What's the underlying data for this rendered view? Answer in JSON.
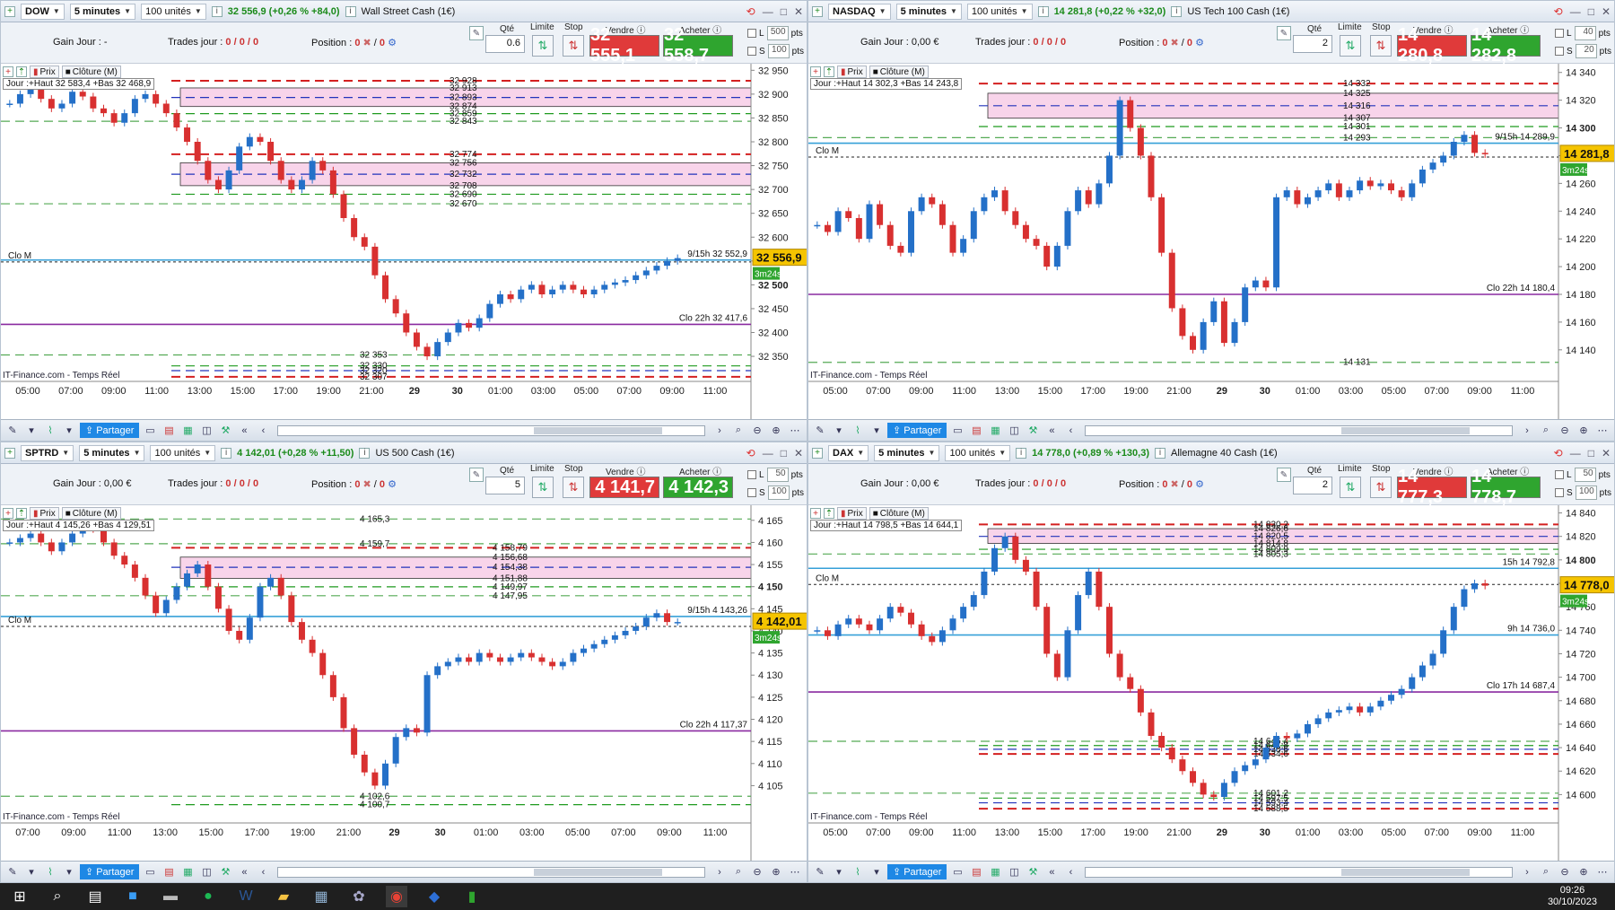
{
  "panels": [
    {
      "symbol": "DOW",
      "timeframe": "5 minutes",
      "units": "100 unités",
      "quote": "32 556,9 (+0,26 % +84,0)",
      "instrument": "Wall Street Cash (1€)",
      "gain_label": "Gain Jour :",
      "gain_value": "-",
      "trades_label": "Trades jour :",
      "trades_value": "0 / 0 / 0",
      "position_label": "Position :",
      "position_value": "0",
      "position_extra": "0",
      "qty_label": "Qté",
      "qty_value": "0.6",
      "limit_label": "Limite",
      "stop_label": "Stop",
      "sell_label": "Vendre",
      "sell_price": "32 555,1",
      "buy_label": "Acheter",
      "buy_price": "32 558,7",
      "l_value": "500",
      "s_value": "100",
      "pts": "pts",
      "tool_prix": "Prix",
      "tool_cloture": "Clôture (M)",
      "jour_info": "Jour :+Haut 32 583,4 +Bas 32 468,9",
      "source": "IT-Finance.com - Temps Réel",
      "share_label": "Partager",
      "price_min": 32320,
      "price_max": 32960,
      "axis_ticks": [
        "32 950",
        "32 900",
        "32 850",
        "32 800",
        "32 750",
        "32 700",
        "32 650",
        "32 600",
        "32 550",
        "32 500",
        "32 450",
        "32 400",
        "32 350"
      ],
      "axis_tick_values": [
        32950,
        32900,
        32850,
        32800,
        32750,
        32700,
        32650,
        32600,
        32550,
        32500,
        32450,
        32400,
        32350
      ],
      "axis_bold": "32 500",
      "time_labels": [
        "05:00",
        "07:00",
        "09:00",
        "11:00",
        "13:00",
        "15:00",
        "17:00",
        "19:00",
        "21:00",
        "29",
        "30",
        "01:00",
        "03:00",
        "05:00",
        "07:00",
        "09:00",
        "11:00"
      ],
      "current_price": "32 556,9",
      "timer": "3m24s",
      "levels": [
        {
          "v": 32928,
          "label": "32 928",
          "style": "red"
        },
        {
          "v": 32913,
          "label": "32 913",
          "style": "pinktop"
        },
        {
          "v": 32893,
          "label": "32 893",
          "style": "blue"
        },
        {
          "v": 32874,
          "label": "32 874",
          "style": "pinkbot"
        },
        {
          "v": 32859,
          "label": "32 859",
          "style": "green"
        },
        {
          "v": 32843,
          "label": "32 843",
          "style": "green2"
        },
        {
          "v": 32774,
          "label": "32 774",
          "style": "red"
        },
        {
          "v": 32756,
          "label": "32 756",
          "style": "pinktop"
        },
        {
          "v": 32732,
          "label": "32 732",
          "style": "blue"
        },
        {
          "v": 32708,
          "label": "32 708",
          "style": "pinkbot"
        },
        {
          "v": 32690,
          "label": "32 690",
          "style": "green"
        },
        {
          "v": 32670,
          "label": "32 670",
          "style": "green2"
        },
        {
          "v": 32353,
          "label": "32 353",
          "style": "green2"
        },
        {
          "v": 32330,
          "label": "32 330",
          "style": "green"
        },
        {
          "v": 32320,
          "label": "32 320",
          "style": "blue"
        },
        {
          "v": 32307,
          "label": "32 307",
          "style": "red"
        }
      ],
      "lines": [
        {
          "v": 32552,
          "label": "9/15h 32 552,9",
          "color": "#36a0d8"
        },
        {
          "v": 32548,
          "label": "Clo M",
          "color": "#222",
          "dash": true,
          "left": true
        },
        {
          "v": 32417,
          "label": "Clo 22h 32 417,6",
          "color": "#8a2aa0"
        }
      ],
      "series": [
        32880,
        32900,
        32910,
        32890,
        32870,
        32880,
        32905,
        32895,
        32870,
        32860,
        32840,
        32860,
        32890,
        32900,
        32880,
        32860,
        32830,
        32800,
        32760,
        32720,
        32700,
        32740,
        32790,
        32810,
        32800,
        32760,
        32720,
        32700,
        32720,
        32760,
        32740,
        32690,
        32640,
        32600,
        32580,
        32520,
        32470,
        32440,
        32400,
        32370,
        32350,
        32380,
        32400,
        32420,
        32410,
        32430,
        32460,
        32480,
        32470,
        32490,
        32500,
        32480,
        32490,
        32500,
        32490,
        32480,
        32490,
        32500,
        32505,
        32510,
        32520,
        32530,
        32540,
        32550,
        32556
      ]
    },
    {
      "symbol": "NASDAQ",
      "timeframe": "5 minutes",
      "units": "100 unités",
      "quote": "14 281,8 (+0,22 % +32,0)",
      "instrument": "US Tech 100 Cash (1€)",
      "gain_label": "Gain Jour :",
      "gain_value": "0,00 €",
      "trades_label": "Trades jour :",
      "trades_value": "0 / 0 / 0",
      "position_label": "Position :",
      "position_value": "0",
      "position_extra": "0",
      "qty_label": "Qté",
      "qty_value": "2",
      "limit_label": "Limite",
      "stop_label": "Stop",
      "sell_label": "Vendre",
      "sell_price": "14 280,8",
      "buy_label": "Acheter",
      "buy_price": "14 282,8",
      "l_value": "40",
      "s_value": "20",
      "pts": "pts",
      "tool_prix": "Prix",
      "tool_cloture": "Clôture (M)",
      "jour_info": "Jour :+Haut 14 302,3 +Bas 14 243,8",
      "source": "IT-Finance.com - Temps Réel",
      "share_label": "Partager",
      "price_min": 14125,
      "price_max": 14345,
      "axis_ticks": [
        "14 340",
        "14 320",
        "14 300",
        "14 280",
        "14 260",
        "14 240",
        "14 220",
        "14 200",
        "14 180",
        "14 160",
        "14 140"
      ],
      "axis_tick_values": [
        14340,
        14320,
        14300,
        14280,
        14260,
        14240,
        14220,
        14200,
        14180,
        14160,
        14140
      ],
      "axis_bold": "14 300",
      "time_labels": [
        "05:00",
        "07:00",
        "09:00",
        "11:00",
        "13:00",
        "15:00",
        "17:00",
        "19:00",
        "21:00",
        "29",
        "30",
        "01:00",
        "03:00",
        "05:00",
        "07:00",
        "09:00",
        "11:00"
      ],
      "current_price": "14 281,8",
      "timer": "3m24s",
      "levels": [
        {
          "v": 14332,
          "label": "14 332",
          "style": "red"
        },
        {
          "v": 14325,
          "label": "14 325",
          "style": "pinktop"
        },
        {
          "v": 14316,
          "label": "14 316",
          "style": "blue"
        },
        {
          "v": 14307,
          "label": "14 307",
          "style": "pinkbot"
        },
        {
          "v": 14301,
          "label": "14 301",
          "style": "green"
        },
        {
          "v": 14293,
          "label": "14 293",
          "style": "green2"
        },
        {
          "v": 14131,
          "label": "14 131",
          "style": "green2"
        }
      ],
      "lines": [
        {
          "v": 14289,
          "label": "9/15h 14 289,9",
          "color": "#36a0d8"
        },
        {
          "v": 14279,
          "label": "Clo M",
          "color": "#222",
          "dash": true,
          "left": true
        },
        {
          "v": 14180,
          "label": "Clo 22h 14 180,4",
          "color": "#8a2aa0"
        }
      ],
      "series": [
        14230,
        14225,
        14240,
        14235,
        14220,
        14245,
        14230,
        14215,
        14210,
        14240,
        14250,
        14245,
        14230,
        14210,
        14220,
        14240,
        14250,
        14255,
        14240,
        14230,
        14220,
        14215,
        14200,
        14215,
        14240,
        14255,
        14245,
        14260,
        14280,
        14320,
        14300,
        14280,
        14250,
        14210,
        14170,
        14150,
        14140,
        14160,
        14175,
        14145,
        14160,
        14185,
        14190,
        14185,
        14250,
        14255,
        14245,
        14250,
        14255,
        14260,
        14250,
        14255,
        14262,
        14258,
        14260,
        14255,
        14250,
        14260,
        14270,
        14275,
        14280,
        14290,
        14295,
        14282,
        14281
      ]
    },
    {
      "symbol": "SPTRD",
      "timeframe": "5 minutes",
      "units": "100 unités",
      "quote": "4 142,01 (+0,28 % +11,50)",
      "instrument": "US 500 Cash (1€)",
      "gain_label": "Gain Jour :",
      "gain_value": "0,00 €",
      "trades_label": "Trades jour :",
      "trades_value": "0 / 0 / 0",
      "position_label": "Position :",
      "position_value": "0",
      "position_extra": "0",
      "qty_label": "Qté",
      "qty_value": "5",
      "limit_label": "Limite",
      "stop_label": "Stop",
      "sell_label": "Vendre",
      "sell_price": "4 141,7",
      "buy_label": "Acheter",
      "buy_price": "4 142,3",
      "l_value": "50",
      "s_value": "100",
      "pts": "pts",
      "tool_prix": "Prix",
      "tool_cloture": "Clôture (M)",
      "jour_info": "Jour :+Haut 4 145,26 +Bas 4 129,51",
      "source": "IT-Finance.com - Temps Réel",
      "share_label": "Partager",
      "price_min": 4099,
      "price_max": 4168,
      "axis_ticks": [
        "4 165",
        "4 160",
        "4 155",
        "4 150",
        "4 145",
        "4 140",
        "4 135",
        "4 130",
        "4 125",
        "4 120",
        "4 115",
        "4 110",
        "4 105"
      ],
      "axis_tick_values": [
        4165,
        4160,
        4155,
        4150,
        4145,
        4140,
        4135,
        4130,
        4125,
        4120,
        4115,
        4110,
        4105
      ],
      "axis_bold": "4 150",
      "time_labels": [
        "07:00",
        "09:00",
        "11:00",
        "13:00",
        "15:00",
        "17:00",
        "19:00",
        "21:00",
        "29",
        "30",
        "01:00",
        "03:00",
        "05:00",
        "07:00",
        "09:00",
        "11:00"
      ],
      "current_price": "4 142,01",
      "timer": "3m24s",
      "levels": [
        {
          "v": 4165.3,
          "label": "4 165,3",
          "style": "green2"
        },
        {
          "v": 4159.7,
          "label": "4 159,7",
          "style": "green2"
        },
        {
          "v": 4158.79,
          "label": "4 158,79",
          "style": "red"
        },
        {
          "v": 4156.68,
          "label": "4 156,68",
          "style": "pinktop"
        },
        {
          "v": 4154.38,
          "label": "4 154,38",
          "style": "blue"
        },
        {
          "v": 4151.88,
          "label": "4 151,88",
          "style": "pinkbot"
        },
        {
          "v": 4149.97,
          "label": "4 149,97",
          "style": "green"
        },
        {
          "v": 4147.95,
          "label": "4 147,95",
          "style": "green2"
        },
        {
          "v": 4102.6,
          "label": "4 102,6",
          "style": "green2"
        },
        {
          "v": 4100.7,
          "label": "4 100,7",
          "style": "green"
        }
      ],
      "lines": [
        {
          "v": 4143.26,
          "label": "9/15h 4 143,26",
          "color": "#36a0d8"
        },
        {
          "v": 4141,
          "label": "Clo M",
          "color": "#222",
          "dash": true,
          "left": true
        },
        {
          "v": 4117.37,
          "label": "Clo 22h 4 117,37",
          "color": "#8a2aa0"
        }
      ],
      "series": [
        4160,
        4161,
        4162,
        4160,
        4158,
        4160,
        4162,
        4164,
        4163,
        4160,
        4157,
        4155,
        4152,
        4148,
        4144,
        4147,
        4150,
        4153,
        4155,
        4150,
        4145,
        4140,
        4138,
        4143,
        4150,
        4152,
        4148,
        4142,
        4138,
        4135,
        4130,
        4125,
        4118,
        4112,
        4108,
        4105,
        4110,
        4116,
        4118,
        4117,
        4130,
        4132,
        4133,
        4134,
        4133,
        4135,
        4134,
        4133,
        4134,
        4135,
        4134,
        4133,
        4132,
        4133,
        4135,
        4136,
        4137,
        4138,
        4139,
        4140,
        4141,
        4143,
        4144,
        4142,
        4142
      ]
    },
    {
      "symbol": "DAX",
      "timeframe": "5 minutes",
      "units": "100 unités",
      "quote": "14 778,0 (+0,89 % +130,3)",
      "instrument": "Allemagne 40 Cash (1€)",
      "gain_label": "Gain Jour :",
      "gain_value": "0,00 €",
      "trades_label": "Trades jour :",
      "trades_value": "0 / 0 / 0",
      "position_label": "Position :",
      "position_value": "0",
      "position_extra": "0",
      "qty_label": "Qté",
      "qty_value": "2",
      "limit_label": "Limite",
      "stop_label": "Stop",
      "sell_label": "Vendre",
      "sell_price": "14 777,3",
      "buy_label": "Acheter",
      "buy_price": "14 778,7",
      "l_value": "50",
      "s_value": "100",
      "pts": "pts",
      "tool_prix": "Prix",
      "tool_cloture": "Clôture (M)",
      "jour_info": "Jour :+Haut 14 798,5 +Bas 14 644,1",
      "source": "IT-Finance.com - Temps Réel",
      "share_label": "Partager",
      "price_min": 14585,
      "price_max": 14845,
      "axis_ticks": [
        "14 840",
        "14 820",
        "14 800",
        "14 780",
        "14 760",
        "14 740",
        "14 720",
        "14 700",
        "14 680",
        "14 660",
        "14 640",
        "14 620",
        "14 600"
      ],
      "axis_tick_values": [
        14840,
        14820,
        14800,
        14780,
        14760,
        14740,
        14720,
        14700,
        14680,
        14660,
        14640,
        14620,
        14600
      ],
      "axis_bold": "14 800",
      "time_labels": [
        "05:00",
        "07:00",
        "09:00",
        "11:00",
        "13:00",
        "15:00",
        "17:00",
        "19:00",
        "21:00",
        "29",
        "30",
        "01:00",
        "03:00",
        "05:00",
        "07:00",
        "09:00",
        "11:00"
      ],
      "current_price": "14 778,0",
      "timer": "3m24s",
      "levels": [
        {
          "v": 14830.2,
          "label": "14 830,2",
          "style": "red"
        },
        {
          "v": 14826.6,
          "label": "14 826,6",
          "style": "pinktop"
        },
        {
          "v": 14820,
          "label": "14 820,5",
          "style": "blue"
        },
        {
          "v": 14814,
          "label": "14 814,8",
          "style": "pinkbot"
        },
        {
          "v": 14809,
          "label": "14 809,9",
          "style": "green"
        },
        {
          "v": 14805,
          "label": "14 805,3",
          "style": "green2"
        },
        {
          "v": 14645.4,
          "label": "14 645,4",
          "style": "green2"
        },
        {
          "v": 14641.8,
          "label": "14 641,8",
          "style": "green"
        },
        {
          "v": 14638.6,
          "label": "14 638,6",
          "style": "blue"
        },
        {
          "v": 14634.6,
          "label": "14 634,6",
          "style": "red"
        },
        {
          "v": 14601.2,
          "label": "14 601,2",
          "style": "green2"
        },
        {
          "v": 14597,
          "label": "14 597,5",
          "style": "green"
        },
        {
          "v": 14593,
          "label": "14 593,4",
          "style": "blue"
        },
        {
          "v": 14588,
          "label": "14 588,5",
          "style": "red"
        }
      ],
      "lines": [
        {
          "v": 14792.8,
          "label": "15h 14 792,8",
          "color": "#36a0d8"
        },
        {
          "v": 14779,
          "label": "Clo M",
          "color": "#222",
          "dash": true,
          "left": true
        },
        {
          "v": 14736,
          "label": "9h 14 736,0",
          "color": "#36a0d8"
        },
        {
          "v": 14687.4,
          "label": "Clo 17h 14 687,4",
          "color": "#8a2aa0"
        }
      ],
      "series": [
        14740,
        14735,
        14745,
        14750,
        14745,
        14740,
        14750,
        14760,
        14755,
        14745,
        14735,
        14730,
        14740,
        14750,
        14760,
        14770,
        14790,
        14810,
        14820,
        14800,
        14790,
        14760,
        14720,
        14700,
        14740,
        14770,
        14790,
        14760,
        14720,
        14700,
        14690,
        14670,
        14650,
        14640,
        14630,
        14620,
        14610,
        14600,
        14598,
        14610,
        14620,
        14625,
        14630,
        14640,
        14650,
        14648,
        14652,
        14660,
        14665,
        14670,
        14672,
        14675,
        14670,
        14675,
        14680,
        14685,
        14690,
        14700,
        14710,
        14720,
        14740,
        14760,
        14775,
        14780,
        14778
      ]
    }
  ],
  "taskbar": {
    "time": "09:26",
    "date": "30/10/2023"
  }
}
